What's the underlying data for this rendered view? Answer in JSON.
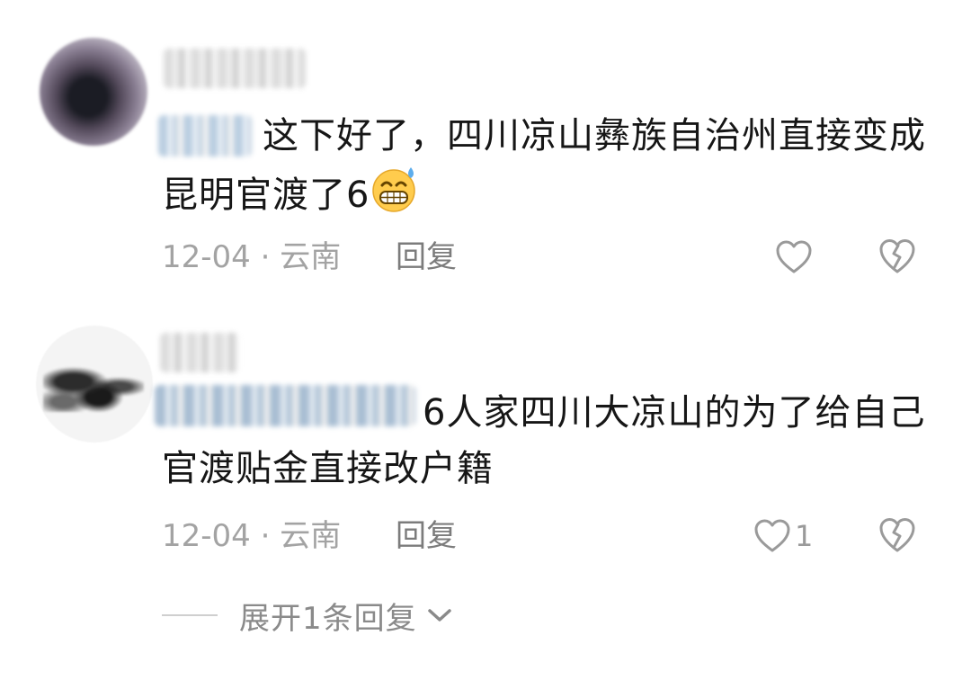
{
  "comments": [
    {
      "avatar_icon": "avatar-image-blurred",
      "mention_icon": "emoji-blurred-icon",
      "text": "这下好了，四川凉山彝族自治州直接变成昆明官渡了6",
      "trailing_emoji": "grinning-sweat-emoji-icon",
      "date": "12-04",
      "separator": "·",
      "location": "云南",
      "reply_label": "回复",
      "like_count": "",
      "like_icon": "heart-outline-icon",
      "dislike_icon": "broken-heart-icon"
    },
    {
      "avatar_icon": "avatar-image-blurred",
      "text": "6人家四川大凉山的为了给自己官渡贴金直接改户籍",
      "date": "12-04",
      "separator": "·",
      "location": "云南",
      "reply_label": "回复",
      "like_count": "1",
      "like_icon": "heart-outline-icon",
      "dislike_icon": "broken-heart-icon"
    }
  ],
  "expand_replies": {
    "label": "展开1条回复",
    "icon": "chevron-down-icon"
  },
  "colors": {
    "text": "#161616",
    "meta": "#a3a3a3",
    "reply": "#7c7c7c",
    "icon": "#9a9a9a",
    "background": "#ffffff"
  }
}
